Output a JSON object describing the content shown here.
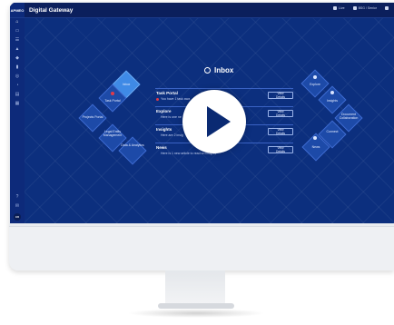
{
  "app": {
    "brand": "APMEO",
    "title": "Digital Gateway"
  },
  "topbar": {
    "items": [
      "Live",
      "BSG / Senior",
      ""
    ]
  },
  "sidebar": {
    "avatar": "DB"
  },
  "diamonds_left": [
    {
      "label": "Inbox"
    },
    {
      "label": "Task Portal"
    },
    {
      "label": "Projects Portal"
    },
    {
      "label": "Legal Entity Management"
    },
    {
      "label": "Data & Analytics"
    }
  ],
  "diamonds_right": [
    {
      "label": "Explore"
    },
    {
      "label": "Insights"
    },
    {
      "label": "Document Collaboration"
    },
    {
      "label": "Connect"
    },
    {
      "label": "News"
    }
  ],
  "inbox": {
    "title": "Inbox",
    "rows": [
      {
        "title": "Task Portal",
        "sub": "You have 1 task awa",
        "button": "View Details",
        "alert": true
      },
      {
        "title": "Explore",
        "sub": "Here is one ne",
        "button": "View Details",
        "alert": false
      },
      {
        "title": "Insights",
        "sub": "Here are 2 insig",
        "button": "View Details",
        "alert": false
      },
      {
        "title": "News",
        "sub": "Here is 1 new article to read on insights",
        "button": "View Details",
        "alert": false
      }
    ]
  },
  "colors": {
    "screen_bg": "#0c2f7e",
    "sidebar_bg": "#0d2a7a",
    "accent_diamond": "#3f8ae6",
    "alert": "#e03a4a"
  }
}
